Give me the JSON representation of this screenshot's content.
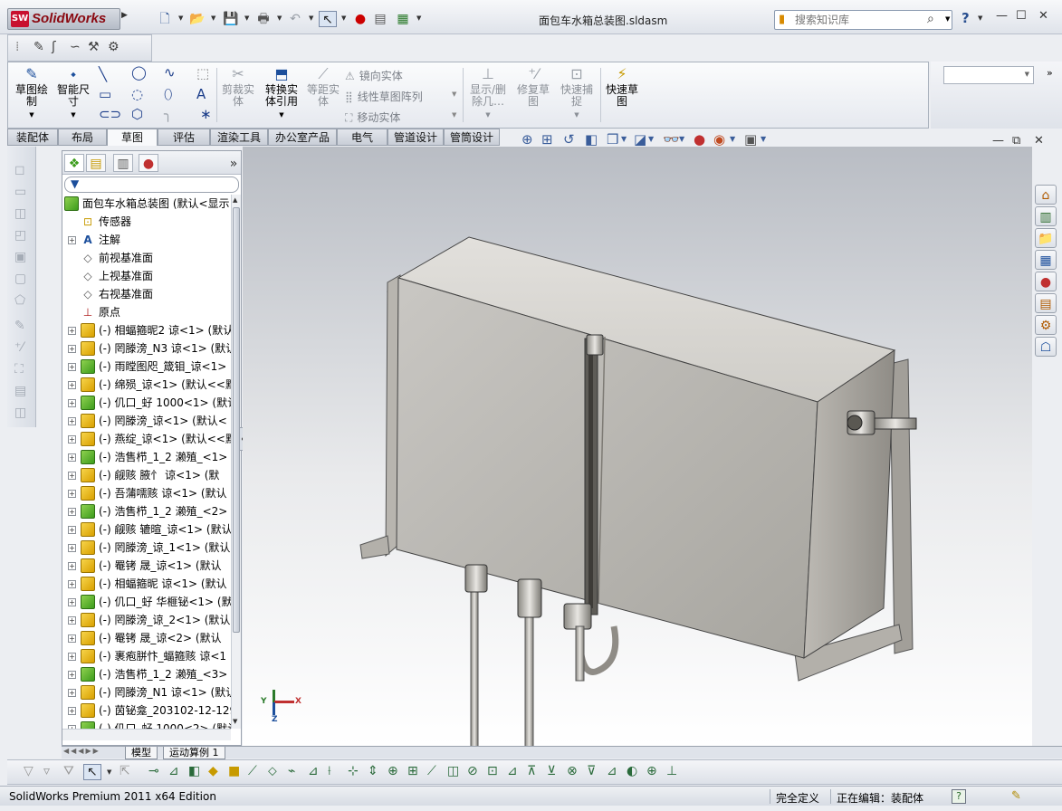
{
  "app": {
    "logo_text": "SolidWorks",
    "logo_badge": "SW",
    "document_title": "面包车水箱总装图.sldasm"
  },
  "search": {
    "placeholder": "搜索知识库"
  },
  "command_manager": {
    "buttons": {
      "sketch": "草图绘\n制",
      "smart_dimension": "智能尺\n寸",
      "trim": "剪裁实\n体",
      "convert": "转换实\n体引用",
      "offset": "等距实\n体",
      "mirror": "镜向实体",
      "linear_pattern": "线性草图阵列",
      "move": "移动实体",
      "show_delete": "显示/删\n除几…",
      "repair": "修复草\n图",
      "quick_snap": "快速捕\n捉",
      "rapid_sketch": "快速草\n图"
    }
  },
  "tabs": [
    "装配体",
    "布局",
    "草图",
    "评估",
    "渲染工具",
    "办公室产品",
    "电气",
    "管道设计",
    "管筒设计"
  ],
  "active_tab": "草图",
  "feature_tree": {
    "root": "面包车水箱总装图 (默认<显示",
    "items": [
      {
        "label": "传感器",
        "icon": "sensor",
        "expandable": false
      },
      {
        "label": "注解",
        "icon": "note",
        "expandable": true
      },
      {
        "label": "前视基准面",
        "icon": "plane",
        "expandable": false
      },
      {
        "label": "上视基准面",
        "icon": "plane",
        "expandable": false
      },
      {
        "label": "右视基准面",
        "icon": "plane",
        "expandable": false
      },
      {
        "label": "原点",
        "icon": "origin",
        "expandable": false
      },
      {
        "label": "(-) 相蝠箍昵2 谅<1> (默认",
        "icon": "part",
        "expandable": true
      },
      {
        "label": "(-) 罔滕滂_N3 谅<1> (默认",
        "icon": "part",
        "expandable": true
      },
      {
        "label": "(-) 雨瞠图咫_箴钼_谅<1>",
        "icon": "asm",
        "expandable": true
      },
      {
        "label": "(-) 绵殒_谅<1> (默认<<默",
        "icon": "part",
        "expandable": true
      },
      {
        "label": "(-) 仉口_虸 1000<1> (默认",
        "icon": "asm",
        "expandable": true
      },
      {
        "label": "(-) 罔滕滂_谅<1> (默认<",
        "icon": "part",
        "expandable": true
      },
      {
        "label": "(-) 燕绽_谅<1> (默认<<默",
        "icon": "part",
        "expandable": true
      },
      {
        "label": "(-) 浩售栉_1_2 濑殖_<1> (",
        "icon": "asm",
        "expandable": true
      },
      {
        "label": "(-) 觎赅 腋忄    谅<1> (默",
        "icon": "part",
        "expandable": true
      },
      {
        "label": "(-) 吾蒲嚅赅 谅<1> (默认",
        "icon": "part",
        "expandable": true
      },
      {
        "label": "(-) 浩售栉_1_2 濑殖_<2> (",
        "icon": "asm",
        "expandable": true
      },
      {
        "label": "(-) 觎赅 辘暄_谅<1> (默认",
        "icon": "part",
        "expandable": true
      },
      {
        "label": "(-) 罔滕滂_谅_1<1> (默认",
        "icon": "part",
        "expandable": true
      },
      {
        "label": "(-) 罨铐   晟_谅<1> (默认",
        "icon": "part",
        "expandable": true
      },
      {
        "label": "(-) 相蝠箍昵 谅<1> (默认",
        "icon": "part",
        "expandable": true
      },
      {
        "label": "(-) 仉口_虸 华榧铋<1> (默",
        "icon": "asm",
        "expandable": true
      },
      {
        "label": "(-) 罔滕滂_谅_2<1> (默认",
        "icon": "part",
        "expandable": true
      },
      {
        "label": "(-) 罨铐   晟_谅<2> (默认",
        "icon": "part",
        "expandable": true
      },
      {
        "label": "(-) 裹疱胼忭_蝠箍赅 谅<1",
        "icon": "part",
        "expandable": true
      },
      {
        "label": "(-) 浩售栉_1_2 濑殖_<3> (",
        "icon": "asm",
        "expandable": true
      },
      {
        "label": "(-) 罔滕滂_N1 谅<1> (默认",
        "icon": "part",
        "expandable": true
      },
      {
        "label": "(-) 茵铋龛_203102-12-129",
        "icon": "part",
        "expandable": true
      },
      {
        "label": "(-) 仉口_虸 1000<2> (默认",
        "icon": "asm",
        "expandable": true
      }
    ]
  },
  "bottom_tabs": [
    "模型",
    "运动算例 1"
  ],
  "status_bar": {
    "edition": "SolidWorks Premium 2011 x64 Edition",
    "definition_state": "完全定义",
    "editing": "正在编辑：装配体",
    "help_glyph": "?"
  },
  "triad": {
    "x": "X",
    "y": "Y",
    "z": "Z"
  },
  "colors": {
    "accent": "#1c4f9c",
    "logo_red": "#c8102e",
    "viewport_top": "#b9bdc4",
    "viewport_bottom": "#ffffff"
  }
}
